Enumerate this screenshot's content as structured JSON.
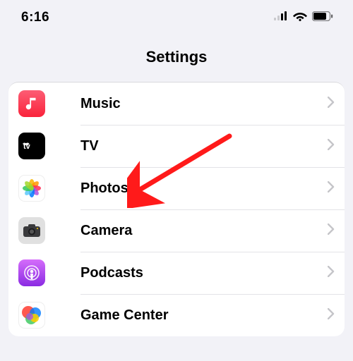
{
  "status": {
    "time": "6:16"
  },
  "header": {
    "title": "Settings"
  },
  "rows": {
    "music": {
      "label": "Music"
    },
    "tv": {
      "label": "TV"
    },
    "photos": {
      "label": "Photos"
    },
    "camera": {
      "label": "Camera"
    },
    "podcasts": {
      "label": "Podcasts"
    },
    "gamectr": {
      "label": "Game Center"
    }
  }
}
